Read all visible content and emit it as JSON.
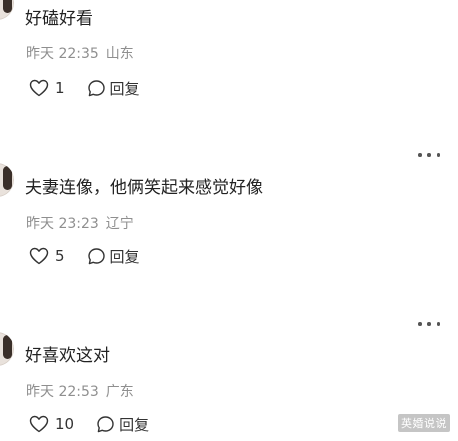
{
  "comments": [
    {
      "text": "好磕好看",
      "time": "昨天 22:35",
      "location": "山东",
      "likes": "1",
      "reply_label": "回复",
      "has_more": false
    },
    {
      "text": "夫妻连像，他俩笑起来感觉好像",
      "time": "昨天 23:23",
      "location": "辽宁",
      "likes": "5",
      "reply_label": "回复",
      "has_more": true
    },
    {
      "text": "好喜欢这对",
      "time": "昨天 22:53",
      "location": "广东",
      "likes": "10",
      "reply_label": "回复",
      "has_more": true
    }
  ],
  "watermark": "英婚说说",
  "colors": {
    "text": "#222222",
    "meta": "#8f8f8f",
    "icon": "#333333"
  }
}
